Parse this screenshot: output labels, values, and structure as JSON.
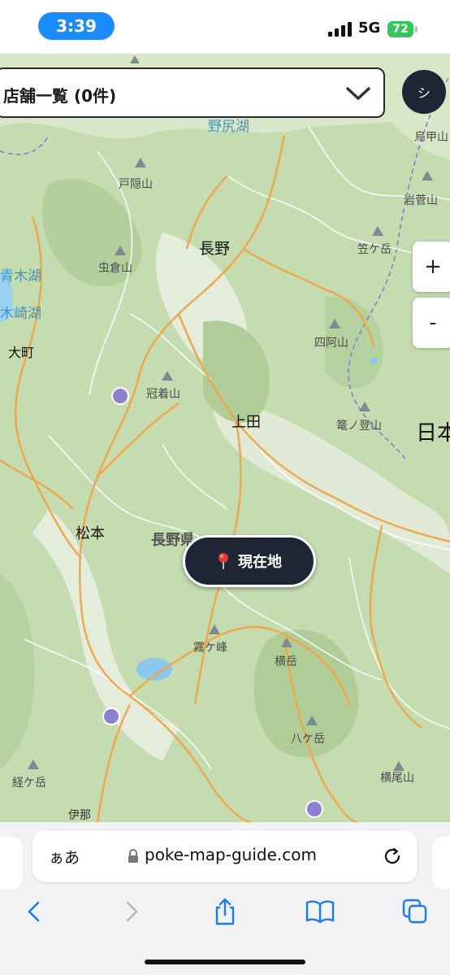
{
  "status_bar": {
    "time": "3:39",
    "network": "5G",
    "battery": "72"
  },
  "header": {
    "store_list_label": "店舗一覧 (0件)",
    "avatar_initial": "シ"
  },
  "map_controls": {
    "zoom_in": "+",
    "zoom_out": "-",
    "locate_label": "現在地"
  },
  "map_labels": {
    "nojiri_lake": "野尻湖",
    "mt_togakushi": "戸隠山",
    "nagano": "長野",
    "mt_mushikura": "虫倉山",
    "aoki_lake": "青木湖",
    "kizaki_lake": "木崎湖",
    "omachi": "大町",
    "mt_kamuriki": "冠着山",
    "ueda": "上田",
    "matsumoto": "松本",
    "nagano_pref": "長野県",
    "kirigamine": "霧ケ峰",
    "mt_yoko": "横岳",
    "yatsugatake": "八ケ岳",
    "mt_kyogatake": "経ケ岳",
    "mt_yokoo": "横尾山",
    "mt_kasagatake": "笠ケ岳",
    "mt_azumaya": "四阿山",
    "mt_kagonotoyama": "篭ノ登山",
    "nihon": "日本",
    "mt_eboshi": "烏甲山",
    "mt_iwasuge": "岩菅山",
    "ina": "伊那"
  },
  "browser": {
    "text_size_button": "ぁあ",
    "url": "poke-map-guide.com"
  },
  "icons": {
    "chevron": "chevron-down-icon",
    "locate": "location-pin-icon",
    "lock": "lock-icon",
    "reload": "reload-icon",
    "back": "back-icon",
    "forward": "forward-icon",
    "share": "share-icon",
    "bookmarks": "bookmarks-icon",
    "tabs": "tabs-icon"
  },
  "colors": {
    "accent_blue": "#1a8cff",
    "dark_navy": "#1e2535",
    "battery_green": "#34c759",
    "map_green": "#c9dfb6",
    "road_orange": "#f0a64a"
  }
}
